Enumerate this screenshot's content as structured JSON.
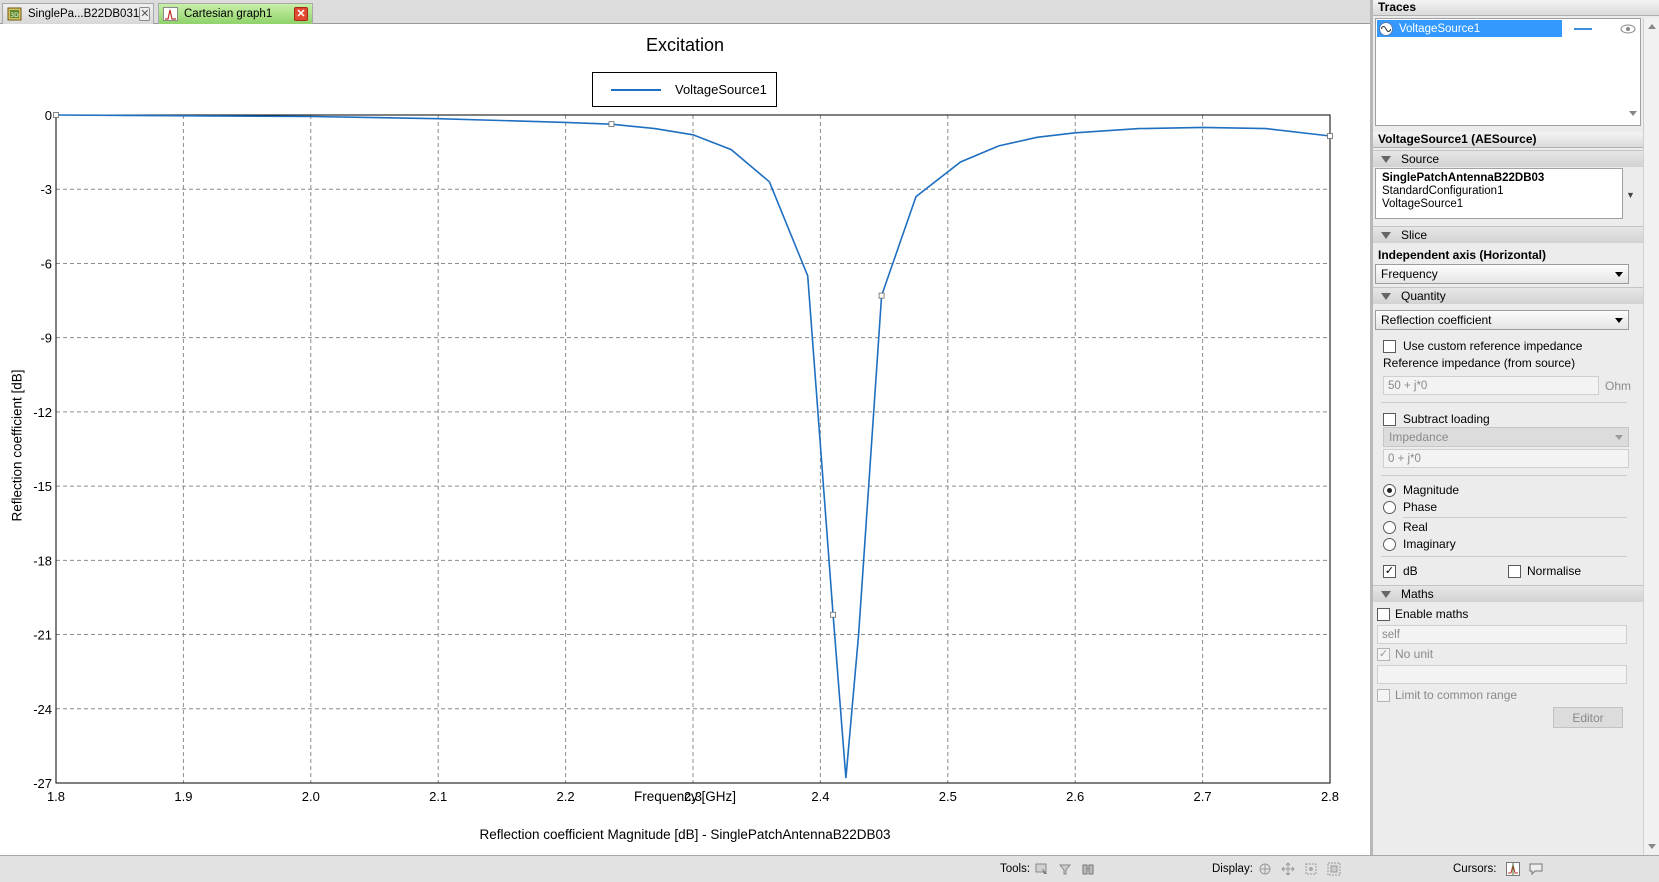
{
  "tabs": [
    {
      "label": "SinglePa...B22DB031",
      "icon": "cad-model-icon",
      "close": "✕"
    },
    {
      "label": "Cartesian graph1",
      "icon": "cartesian-graph-icon",
      "close": "✕"
    }
  ],
  "graph": {
    "title": "Excitation",
    "legend": "VoltageSource1",
    "xlabel": "Frequency [GHz]",
    "ylabel": "Reflection coefficient [dB]",
    "caption": "Reflection coefficient Magnitude [dB] - SinglePatchAntennaB22DB03"
  },
  "chart_data": {
    "type": "line",
    "title": "Excitation",
    "xlabel": "Frequency [GHz]",
    "ylabel": "Reflection coefficient [dB]",
    "xlim": [
      1.8,
      2.8
    ],
    "ylim": [
      -27,
      0
    ],
    "xticks": [
      "1.8",
      "1.9",
      "2.0",
      "2.1",
      "2.2",
      "2.3",
      "2.4",
      "2.5",
      "2.6",
      "2.7",
      "2.8"
    ],
    "yticks": [
      "0",
      "-3",
      "-6",
      "-9",
      "-12",
      "-15",
      "-18",
      "-21",
      "-24",
      "-27"
    ],
    "grid": true,
    "legend_position": "top-center",
    "series": [
      {
        "name": "VoltageSource1",
        "color": "#1f6fc1",
        "x": [
          1.8,
          2.0,
          2.1,
          2.2,
          2.236,
          2.27,
          2.3,
          2.33,
          2.36,
          2.39,
          2.41,
          2.42,
          2.43,
          2.448,
          2.475,
          2.51,
          2.54,
          2.57,
          2.6,
          2.65,
          2.7,
          2.75,
          2.8
        ],
        "y": [
          0.0,
          -0.06,
          -0.15,
          -0.3,
          -0.37,
          -0.55,
          -0.8,
          -1.4,
          -2.7,
          -6.5,
          -20.2,
          -26.8,
          -21.0,
          -7.3,
          -3.3,
          -1.9,
          -1.25,
          -0.9,
          -0.72,
          -0.55,
          -0.5,
          -0.55,
          -0.85
        ],
        "markers_at": [
          1.8,
          2.236,
          2.41,
          2.448,
          2.8
        ]
      }
    ]
  },
  "panel": {
    "traces_header": "Traces",
    "trace_name": "VoltageSource1",
    "trace_color": "#1f6fc1",
    "properties_header": "VoltageSource1 (AESource)",
    "source_section": "Source",
    "source_lines": [
      "SinglePatchAntennaB22DB03",
      "StandardConfiguration1",
      "VoltageSource1"
    ],
    "slice_section": "Slice",
    "indep_axis_label": "Independent axis (Horizontal)",
    "indep_axis_value": "Frequency",
    "quantity_section": "Quantity",
    "quantity_value": "Reflection coefficient",
    "custom_ref_label": "Use custom reference impedance",
    "ref_impedance_label": "Reference impedance (from source)",
    "ref_impedance_value": "50 + j*0",
    "ref_impedance_unit": "Ohm",
    "subtract_loading_label": "Subtract loading",
    "loading_type": "Impedance",
    "loading_value": "0 + j*0",
    "radio_magnitude": "Magnitude",
    "radio_phase": "Phase",
    "radio_real": "Real",
    "radio_imaginary": "Imaginary",
    "db_label": "dB",
    "normalise_label": "Normalise",
    "maths_section": "Maths",
    "enable_maths_label": "Enable maths",
    "maths_expression": "self",
    "no_unit_label": "No unit",
    "limit_label": "Limit to common range",
    "editor_button": "Editor",
    "check_mark": "✓"
  },
  "statusbar": {
    "tools_label": "Tools:",
    "display_label": "Display:",
    "cursors_label": "Cursors:"
  }
}
